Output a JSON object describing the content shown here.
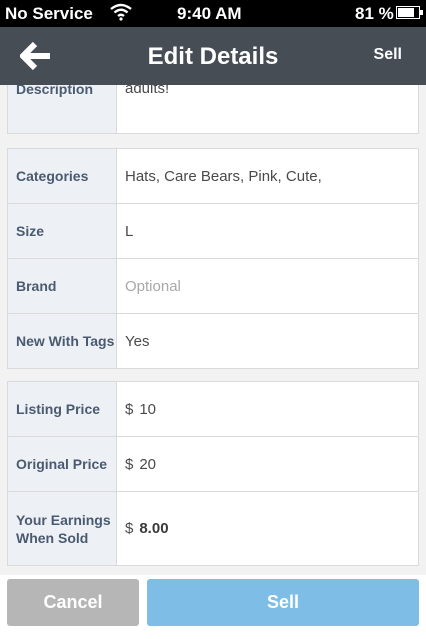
{
  "status_bar": {
    "carrier": "No Service",
    "time": "9:40 AM",
    "battery_percent": "81 %",
    "battery_level": 0.81
  },
  "nav": {
    "title": "Edit Details",
    "right_action": "Sell",
    "back_icon": "arrow-left-icon"
  },
  "description": {
    "label": "Description",
    "value": "adults!"
  },
  "details": [
    {
      "label": "Categories",
      "value": "Hats, Care Bears, Pink, Cute,",
      "is_placeholder": false
    },
    {
      "label": "Size",
      "value": "L",
      "is_placeholder": false
    },
    {
      "label": "Brand",
      "value": "Optional",
      "is_placeholder": true
    },
    {
      "label": "New With Tags",
      "value": "Yes",
      "is_placeholder": false
    }
  ],
  "pricing": {
    "currency": "$",
    "listing_label": "Listing Price",
    "listing_value": "10",
    "original_label": "Original Price",
    "original_value": "20",
    "earnings_label": "Your Earnings When Sold",
    "earnings_value": "8.00"
  },
  "buttons": {
    "cancel": "Cancel",
    "sell": "Sell"
  },
  "colors": {
    "nav_bg": "#474d55",
    "label_bg": "#edf1f5",
    "label_text": "#4a5a70",
    "sell_button": "#7ebde6",
    "cancel_button": "#b6b6b6"
  }
}
